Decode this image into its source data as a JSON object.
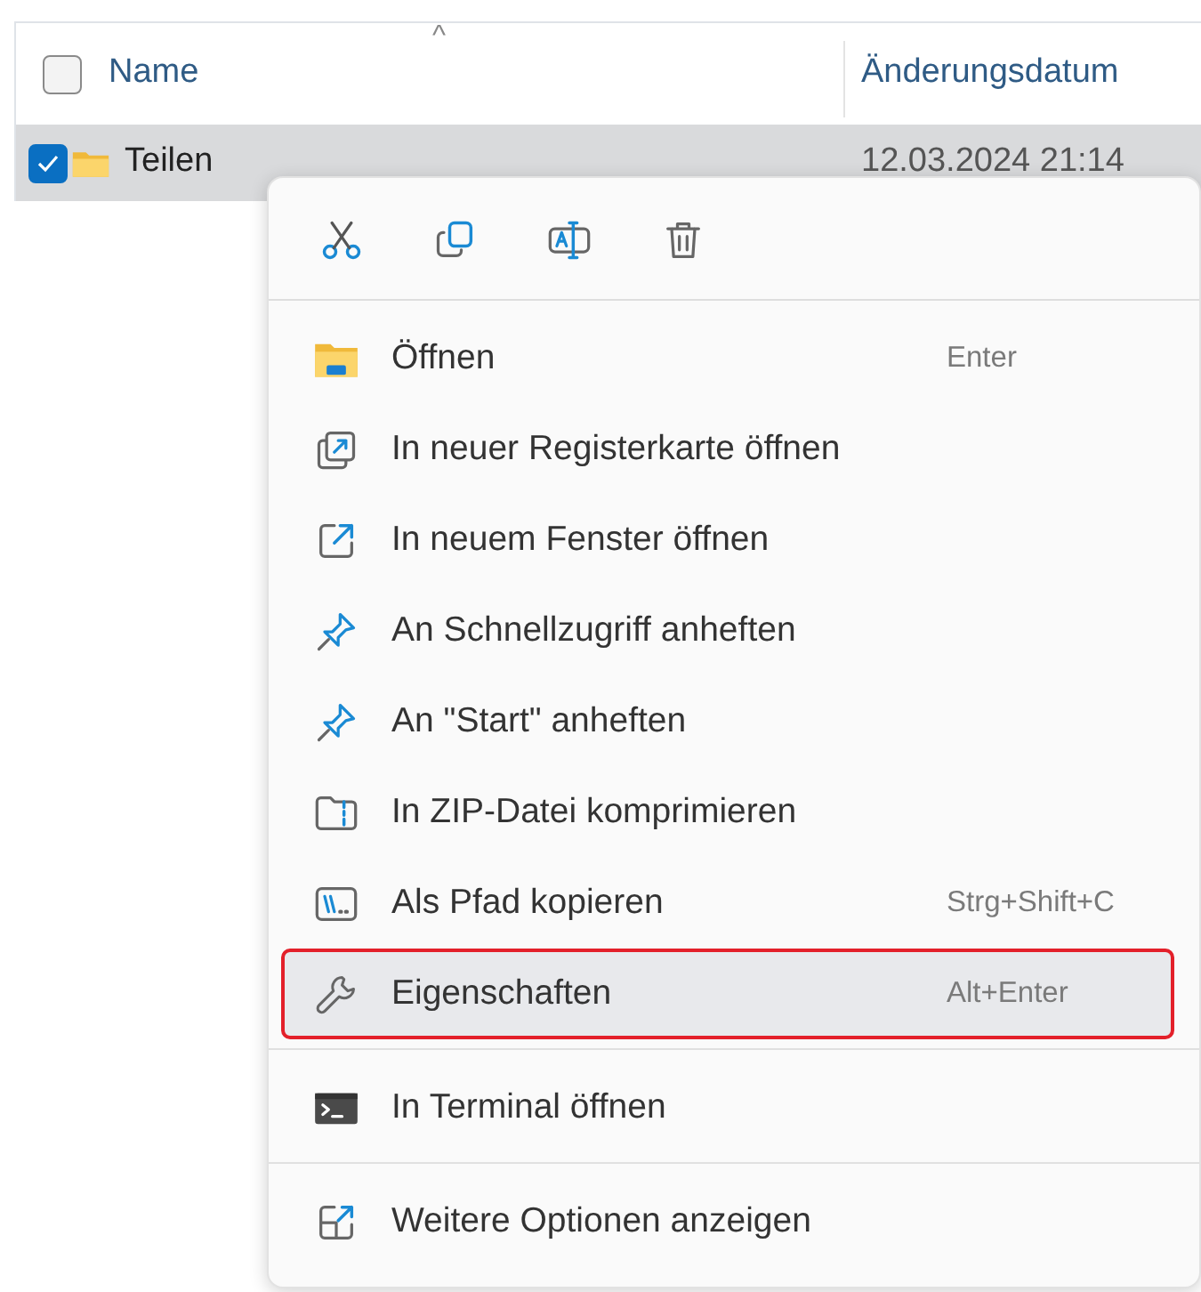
{
  "file_list": {
    "header": {
      "select_all_checked": false,
      "columns": [
        "Name",
        "Änderungsdatum"
      ],
      "sort_indicator": "^"
    },
    "rows": [
      {
        "name": "Teilen",
        "date": "12.03.2024 21:14",
        "selected": true,
        "checked": true
      }
    ]
  },
  "context_menu": {
    "sections": [
      [
        {
          "label": "Öffnen",
          "shortcut": "Enter",
          "selected": false,
          "outlined": false
        },
        {
          "label": "In neuer Registerkarte öffnen",
          "selected": false,
          "outlined": false
        },
        {
          "label": "In neuem Fenster öffnen",
          "selected": false,
          "outlined": false
        },
        {
          "label": "An Schnellzugriff anheften",
          "selected": false,
          "outlined": false
        },
        {
          "label": "An \"Start\" anheften",
          "selected": false,
          "outlined": false
        },
        {
          "label": "In ZIP-Datei komprimieren",
          "selected": false,
          "outlined": false
        },
        {
          "label": "Als Pfad kopieren",
          "shortcut": "Strg+Shift+C",
          "selected": false,
          "outlined": false
        },
        {
          "label": "Eigenschaften",
          "shortcut": "Alt+Enter",
          "selected": true,
          "outlined": true
        }
      ],
      [
        {
          "label": "In Terminal öffnen",
          "selected": false,
          "outlined": false
        }
      ],
      [
        {
          "label": "Weitere Optionen anzeigen",
          "selected": false,
          "outlined": false
        }
      ]
    ]
  }
}
